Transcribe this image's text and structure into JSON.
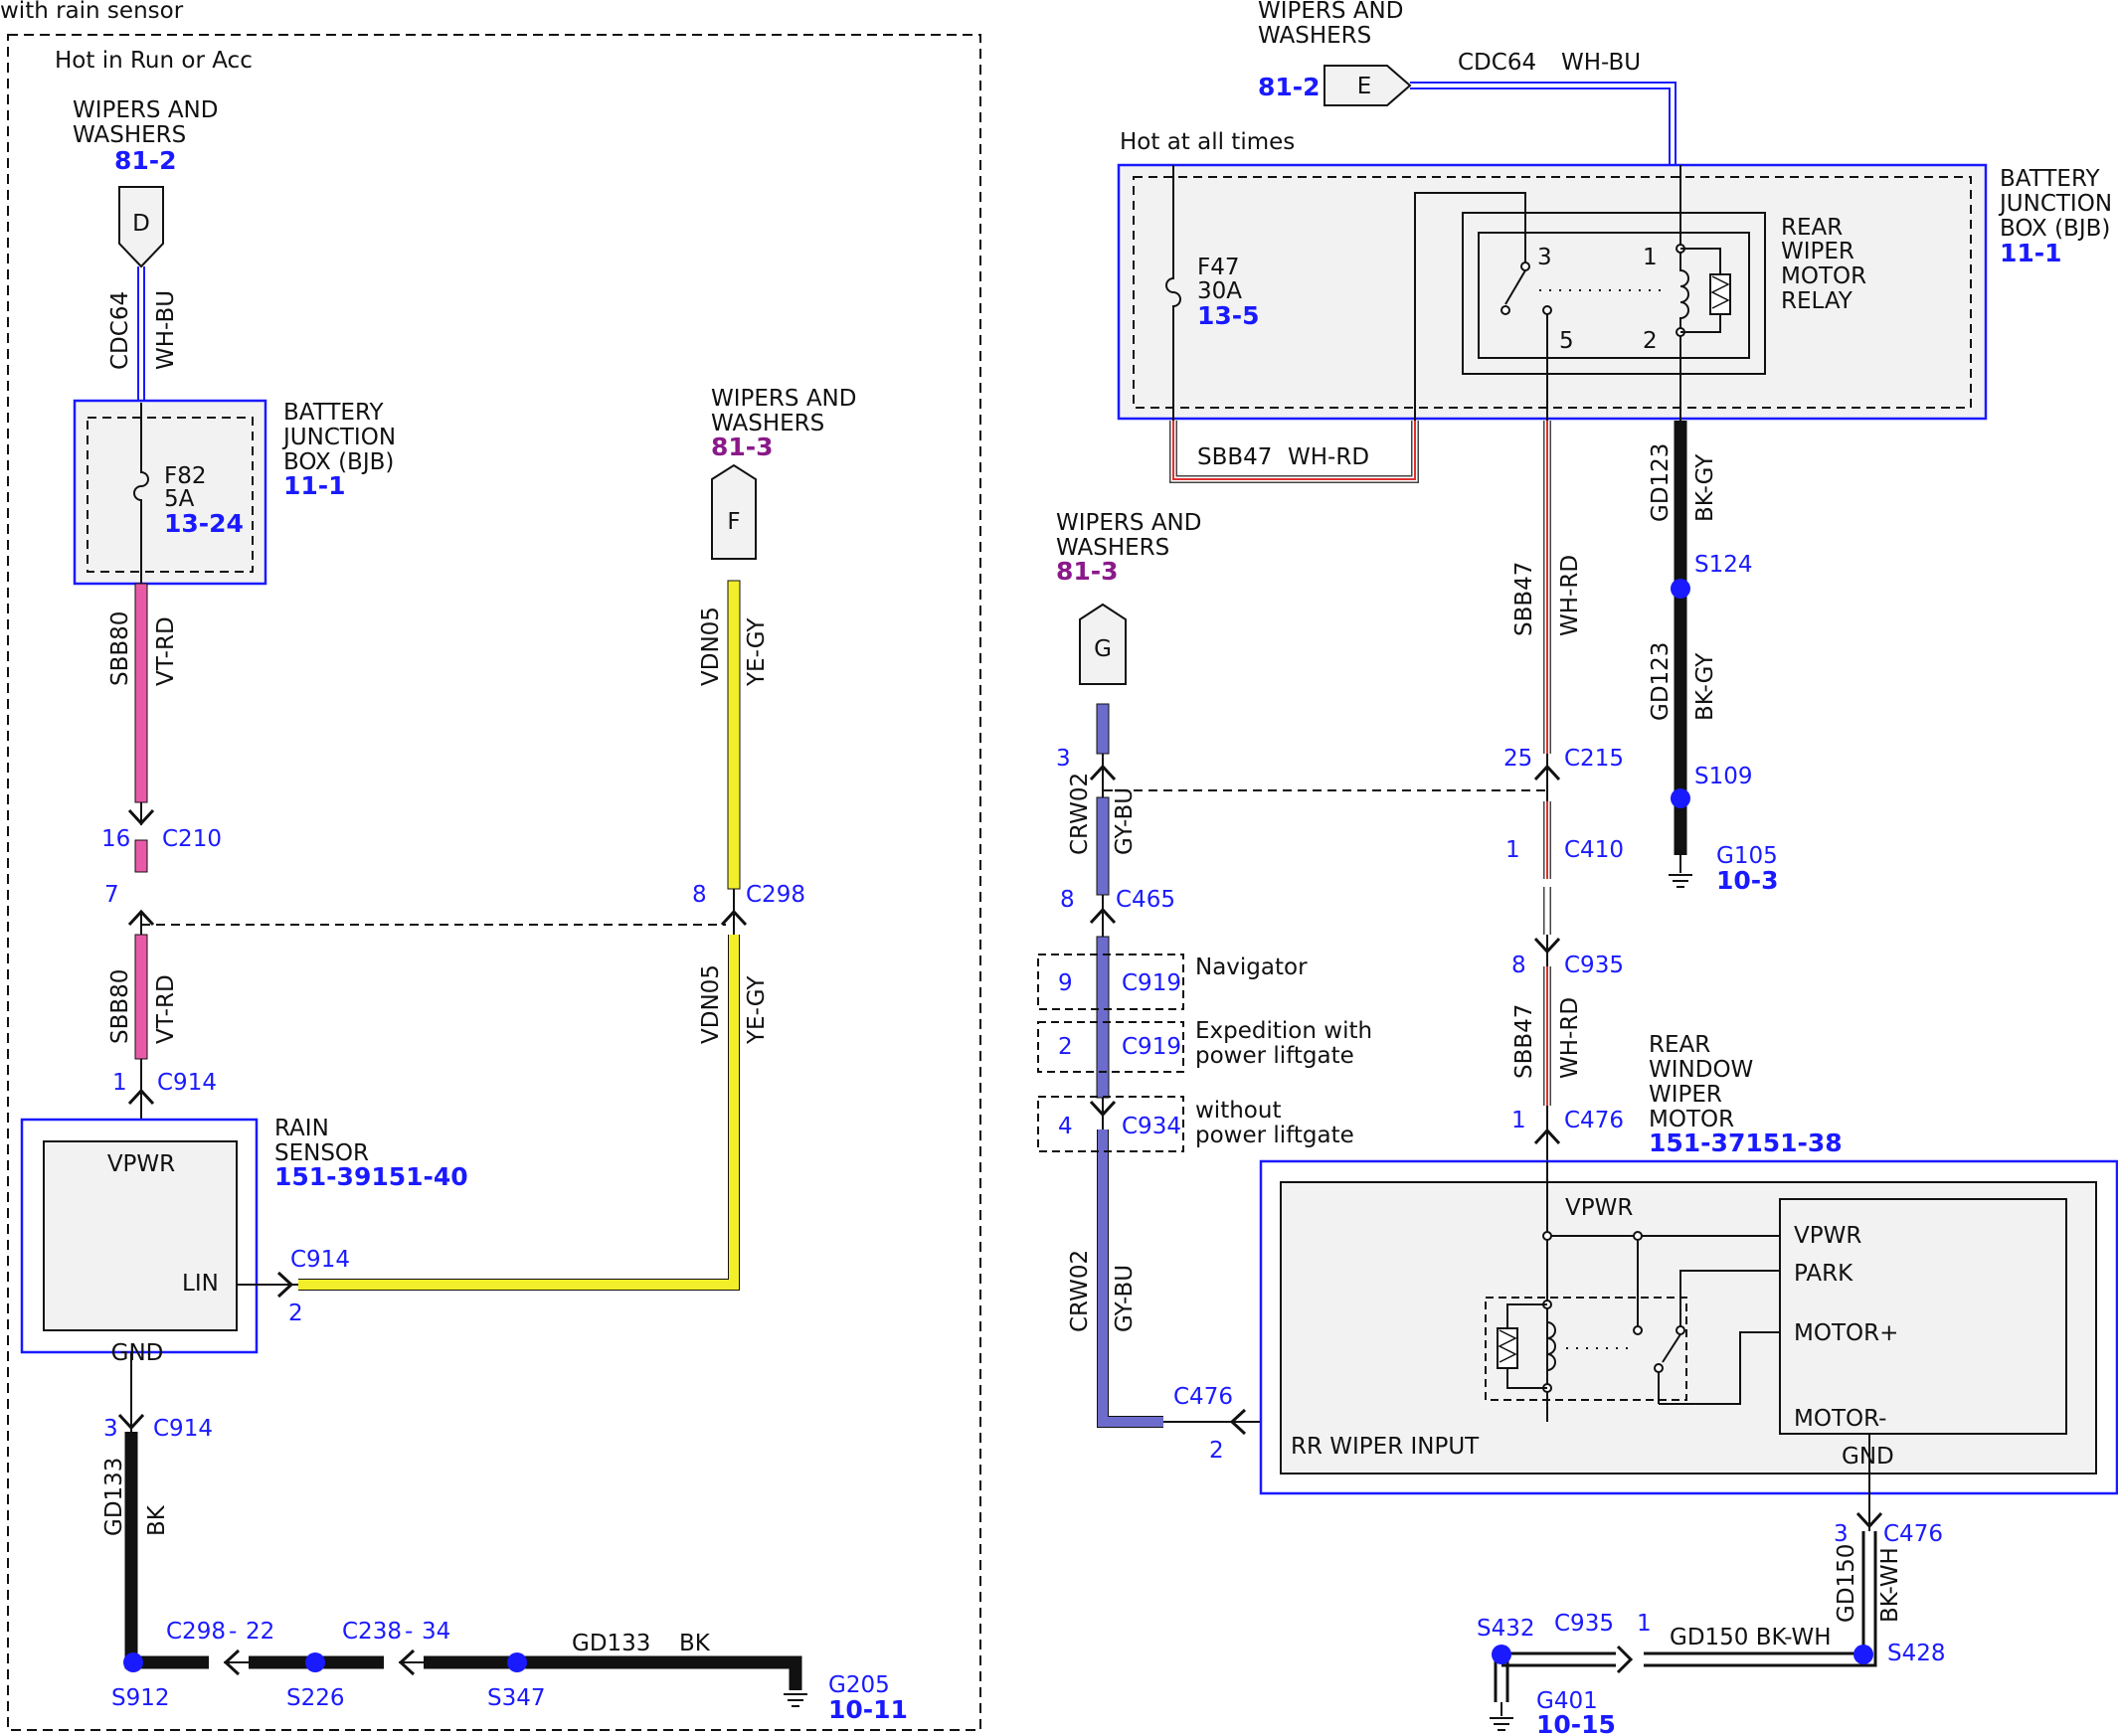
{
  "top_left_note": "with rain sensor",
  "left_block": {
    "hot_label": "Hot in Run or Acc",
    "wipers_D": {
      "title1": "WIPERS AND",
      "title2": "WASHERS",
      "ref": "81-2",
      "conn": "D"
    },
    "wire_cdc64": {
      "circuit": "CDC64",
      "color": "WH-BU"
    },
    "bjb": {
      "l1": "BATTERY",
      "l2": "JUNCTION",
      "l3": "BOX (BJB)",
      "ref": "11-1",
      "fuse": "F82",
      "amps": "5A",
      "fuse_ref": "13-24"
    },
    "wire_sbb80_top": {
      "circuit": "SBB80",
      "color": "VT-RD"
    },
    "c210": {
      "pin_top": "16",
      "name": "C210",
      "pin_bottom": "7"
    },
    "wire_sbb80_bot": {
      "circuit": "SBB80",
      "color": "VT-RD"
    },
    "c914_top": {
      "pin": "1",
      "name": "C914"
    },
    "rain_sensor": {
      "l1": "RAIN",
      "l2": "SENSOR",
      "ref": "151-39151-40",
      "vpwr": "VPWR",
      "lin": "LIN",
      "gnd": "GND"
    },
    "lin_conn": {
      "name": "C914",
      "pin": "2"
    },
    "gnd_conn": {
      "pin": "3",
      "name": "C914"
    },
    "wire_gd133_v": {
      "circuit": "GD133",
      "color": "BK"
    },
    "wipers_F": {
      "title1": "WIPERS AND",
      "title2": "WASHERS",
      "ref": "81-3",
      "conn": "F"
    },
    "wire_vdn05_top": {
      "circuit": "VDN05",
      "color": "YE-GY"
    },
    "c298": {
      "pin": "8",
      "name": "C298"
    },
    "wire_vdn05_bot": {
      "circuit": "VDN05",
      "color": "YE-GY"
    },
    "ground_run": {
      "c298_22": {
        "name": "C298",
        "sep": "-",
        "pin": "22"
      },
      "c238_34": {
        "name": "C238",
        "sep": "-",
        "pin": "34"
      },
      "wire": {
        "circuit": "GD133",
        "color": "BK"
      },
      "s912": "S912",
      "s226": "S226",
      "s347": "S347",
      "g205": "G205",
      "g205_ref": "10-11"
    }
  },
  "right_block": {
    "wipers_E": {
      "title1": "WIPERS AND",
      "title2": "WASHERS",
      "ref": "81-2",
      "conn": "E"
    },
    "wire_cdc64": {
      "circuit": "CDC64",
      "color": "WH-BU"
    },
    "hot_label": "Hot at all times",
    "bjb": {
      "l1": "BATTERY",
      "l2": "JUNCTION",
      "l3": "BOX (BJB)",
      "ref": "11-1",
      "fuse": "F47",
      "amps": "30A",
      "fuse_ref": "13-5"
    },
    "relay": {
      "l1": "REAR",
      "l2": "WIPER",
      "l3": "MOTOR",
      "l4": "RELAY",
      "p3": "3",
      "p1": "1",
      "p5": "5",
      "p2": "2"
    },
    "wire_sbb47_loop": {
      "circuit": "SBB47",
      "color": "WH-RD"
    },
    "wire_sbb47_v1": {
      "circuit": "SBB47",
      "color": "WH-RD"
    },
    "wire_gd123_a": {
      "circuit": "GD123",
      "color": "BK-GY"
    },
    "s124": "S124",
    "wire_gd123_b": {
      "circuit": "GD123",
      "color": "BK-GY"
    },
    "s109": "S109",
    "g105": "G105",
    "g105_ref": "10-3",
    "c215": {
      "pin": "25",
      "name": "C215"
    },
    "c410": {
      "pin": "1",
      "name": "C410"
    },
    "c935_top": {
      "pin": "8",
      "name": "C935"
    },
    "wire_sbb47_v2": {
      "circuit": "SBB47",
      "color": "WH-RD"
    },
    "c476_top": {
      "pin": "1",
      "name": "C476"
    },
    "wipers_G": {
      "title1": "WIPERS AND",
      "title2": "WASHERS",
      "ref": "81-3",
      "conn": "G"
    },
    "g_pin": "3",
    "wire_crw02_top": {
      "circuit": "CRW02",
      "color": "GY-BU"
    },
    "c465": {
      "pin": "8",
      "name": "C465"
    },
    "options": [
      {
        "pin": "9",
        "name": "C919",
        "label1": "Navigator",
        "label2": ""
      },
      {
        "pin": "2",
        "name": "C919",
        "label1": "Expedition with",
        "label2": "power liftgate"
      },
      {
        "pin": "4",
        "name": "C934",
        "label1": "without",
        "label2": "power liftgate"
      }
    ],
    "wire_crw02_bot": {
      "circuit": "CRW02",
      "color": "GY-BU"
    },
    "c476_in": {
      "name": "C476",
      "pin": "2"
    },
    "motor": {
      "l1": "REAR",
      "l2": "WINDOW",
      "l3": "WIPER",
      "l4": "MOTOR",
      "ref": "151-37151-38",
      "vpwr_top": "VPWR",
      "rr": "RR WIPER INPUT",
      "vpwr": "VPWR",
      "park": "PARK",
      "motor_plus": "MOTOR+",
      "motor_minus": "MOTOR-",
      "gnd": "GND"
    },
    "c476_gnd": {
      "pin": "3",
      "name": "C476"
    },
    "wire_gd150_v": {
      "circuit": "GD150",
      "color": "BK-WH"
    },
    "s432": "S432",
    "c935_bot": {
      "name": "C935",
      "pin": "1"
    },
    "wire_gd150_h": {
      "circuit": "GD150 BK-WH"
    },
    "s428": "S428",
    "g401": "G401",
    "g401_ref": "10-15"
  },
  "colors": {
    "blue": "#1a1aff",
    "purple": "#8a1a8a",
    "wire_pink": "#e85aa8",
    "wire_yellow": "#f2ee2a",
    "wire_red": "#e03030",
    "wire_gybu": "#6c6ccc",
    "box_fill": "#f2f2f2"
  }
}
